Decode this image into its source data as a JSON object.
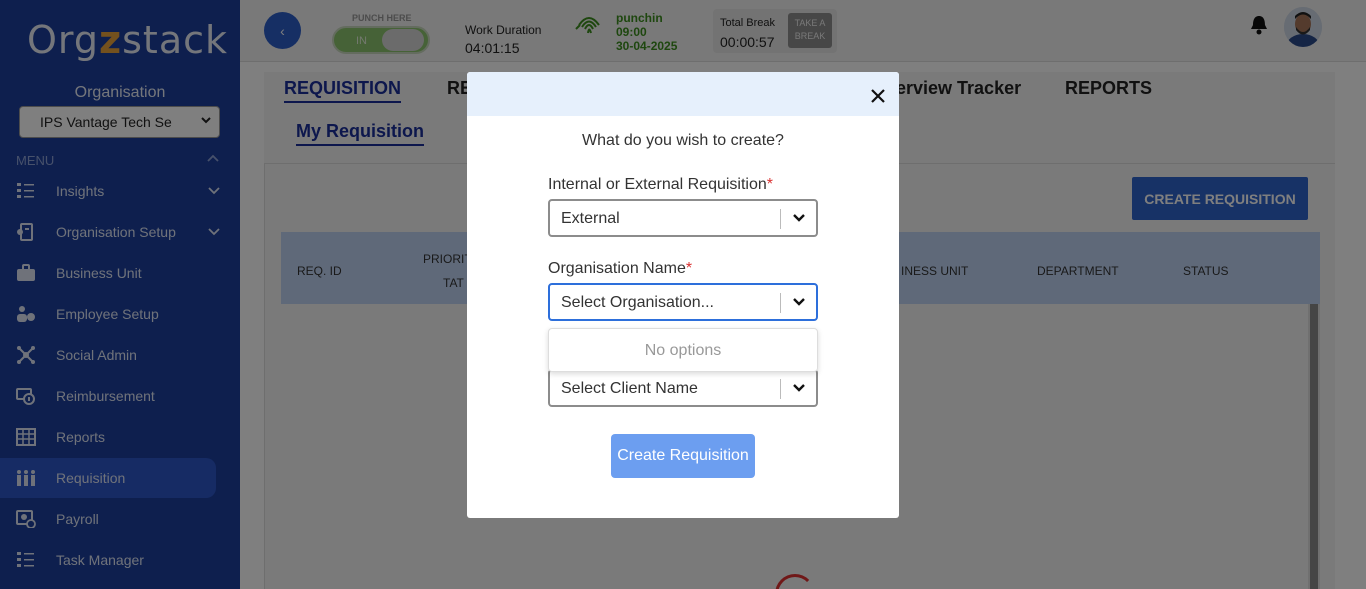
{
  "sidebar": {
    "logo": {
      "pre": "Org",
      "mid": "z",
      "post": "stack"
    },
    "org_label": "Organisation",
    "org_select_value": "IPS Vantage Tech Se",
    "menu_label": "MENU",
    "items": [
      {
        "label": "Insights",
        "icon": "insights-icon",
        "expandable": true
      },
      {
        "label": "Organisation Setup",
        "icon": "organisation-setup-icon",
        "expandable": true
      },
      {
        "label": "Business Unit",
        "icon": "briefcase-icon",
        "expandable": false
      },
      {
        "label": "Employee Setup",
        "icon": "employee-setup-icon",
        "expandable": false
      },
      {
        "label": "Social Admin",
        "icon": "social-admin-icon",
        "expandable": false
      },
      {
        "label": "Reimbursement",
        "icon": "reimbursement-icon",
        "expandable": false
      },
      {
        "label": "Reports",
        "icon": "reports-icon",
        "expandable": false
      },
      {
        "label": "Requisition",
        "icon": "requisition-icon",
        "expandable": false,
        "active": true
      },
      {
        "label": "Payroll",
        "icon": "payroll-icon",
        "expandable": false
      },
      {
        "label": "Task Manager",
        "icon": "task-manager-icon",
        "expandable": false
      }
    ]
  },
  "topbar": {
    "back_glyph": "‹",
    "punch_label": "PUNCH HERE",
    "punch_state": "IN",
    "work_duration_label": "Work Duration",
    "work_duration_value": "04:01:15",
    "punchin_label": "punchin",
    "punchin_time": "09:00",
    "punchin_date": "30-04-2025",
    "total_break_label": "Total Break",
    "total_break_value": "00:00:57",
    "take_break_line1": "TAKE A",
    "take_break_line2": "BREAK"
  },
  "main": {
    "tabs": [
      "REQUISITION",
      "RE",
      "terview Tracker",
      "REPORTS"
    ],
    "sub_tab": "My Requisition",
    "create_button": "CREATE REQUISITION",
    "columns": {
      "req_id": "REQ. ID",
      "priority": "PRIORIT",
      "tat": "TAT",
      "business_unit": "INESS UNIT",
      "department": "DEPARTMENT",
      "status": "STATUS"
    }
  },
  "modal": {
    "question": "What do you wish to create?",
    "field1_label": "Internal or External Requisition",
    "field1_value": "External",
    "field2_label": "Organisation Name",
    "field2_placeholder": "Select Organisation...",
    "dropdown_message": "No options",
    "field3_placeholder": "Select Client Name",
    "required_mark": "*",
    "submit_label": "Create Requisition"
  },
  "colors": {
    "sidebar_bg": "#1c3f9c",
    "sidebar_active": "#2d57c9",
    "accent": "#2f64cc",
    "punch_green": "#8dc46e",
    "punchin_text": "#3d8f1e",
    "table_header": "#bed3f3",
    "modal_header": "#e6f0fc",
    "submit_btn": "#6c9ef0",
    "required": "#d93030"
  }
}
